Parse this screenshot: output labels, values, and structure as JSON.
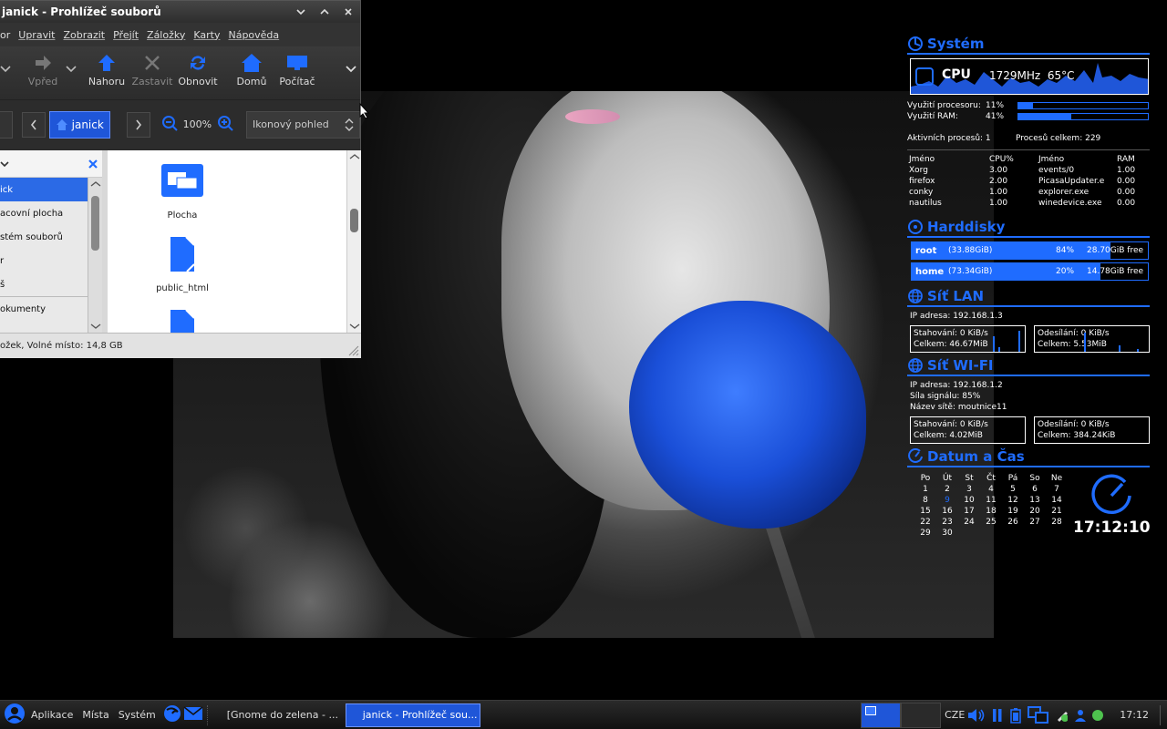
{
  "file_manager": {
    "title": "janick - Prohlížeč souborů",
    "menu": [
      "or",
      "Upravit",
      "Zobrazit",
      "Přejít",
      "Záložky",
      "Karty",
      "Nápověda"
    ],
    "toolbar": {
      "forward": "Vpřed",
      "up": "Nahoru",
      "stop": "Zastavit",
      "reload": "Obnovit",
      "home": "Domů",
      "computer": "Počítač"
    },
    "location": {
      "crumb": "janick",
      "zoom": "100%",
      "view": "Ikonový pohled"
    },
    "sidebar_items": [
      "ick",
      "acovní plocha",
      "stém souborů",
      "r",
      "š",
      "okumenty"
    ],
    "files": [
      "Plocha",
      "public_html"
    ],
    "status": "ožek, Volné místo: 14,8 GB"
  },
  "conky": {
    "system": {
      "title": "Systém",
      "cpu_label": "CPU",
      "cpu_freq": "1729MHz",
      "cpu_temp": "65°C",
      "cpu_usage_label": "Využití procesoru:",
      "cpu_usage": "11%",
      "cpu_usage_value": 11,
      "ram_label": "Využití RAM:",
      "ram_usage": "41%",
      "ram_usage_value": 41,
      "active_procs": "Aktivních procesů: 1",
      "total_procs": "Procesů celkem: 229",
      "cpu_headers": [
        "Jméno",
        "CPU%"
      ],
      "ram_headers": [
        "Jméno",
        "RAM"
      ],
      "cpu_procs": [
        [
          "Xorg",
          "3.00"
        ],
        [
          "firefox",
          "2.00"
        ],
        [
          "conky",
          "1.00"
        ],
        [
          "nautilus",
          "1.00"
        ]
      ],
      "ram_procs": [
        [
          "events/0",
          "1.00"
        ],
        [
          "PicasaUpdater.e",
          "0.00"
        ],
        [
          "explorer.exe",
          "0.00"
        ],
        [
          "winedevice.exe",
          "0.00"
        ]
      ]
    },
    "disks": {
      "title": "Harddisky",
      "items": [
        {
          "name": "root",
          "size": "(33.88GiB)",
          "pct": "84%",
          "free": "28.70GiB free",
          "used": 84
        },
        {
          "name": "home",
          "size": "(73.34GiB)",
          "pct": "20%",
          "free": "14.78GiB free",
          "used": 80
        }
      ]
    },
    "lan": {
      "title": "Síť LAN",
      "ip": "IP adresa: 192.168.1.3",
      "down": "Stahování:  0  KiB/s",
      "down_total": "Celkem: 46.67MiB",
      "up": "Odesílání: 0 KiB/s",
      "up_total": "Celkem:  5.53MiB"
    },
    "wifi": {
      "title": "Síť WI-FI",
      "ip": "IP adresa: 192.168.1.2",
      "signal": "Síla signálu: 85%",
      "ssid": "Název sítě: moutnice11",
      "down": "Stahování:  0  KiB/s",
      "down_total": "Celkem: 4.02MiB",
      "up": "Odesílání: 0 KiB/s",
      "up_total": "Celkem:  384.24KiB"
    },
    "datetime": {
      "title": "Datum a Čas",
      "weekdays": [
        "Po",
        "Út",
        "St",
        "Čt",
        "Pá",
        "So",
        "Ne"
      ],
      "days": [
        "1",
        "2",
        "3",
        "4",
        "5",
        "6",
        "7",
        "8",
        "9",
        "10",
        "11",
        "12",
        "13",
        "14",
        "15",
        "16",
        "17",
        "18",
        "19",
        "20",
        "21",
        "22",
        "23",
        "24",
        "25",
        "26",
        "27",
        "28",
        "29",
        "30"
      ],
      "today": "9",
      "time": "17:12:10"
    }
  },
  "taskbar": {
    "apps": "Aplikace",
    "places": "Místa",
    "system": "Systém",
    "task1": "[Gnome do zelena - ...",
    "task2": "janick - Prohlížeč sou...",
    "layout": "CZE",
    "clock": "17:12"
  },
  "colors": {
    "accent": "#1f6cff",
    "selection": "#2b6ae6"
  }
}
